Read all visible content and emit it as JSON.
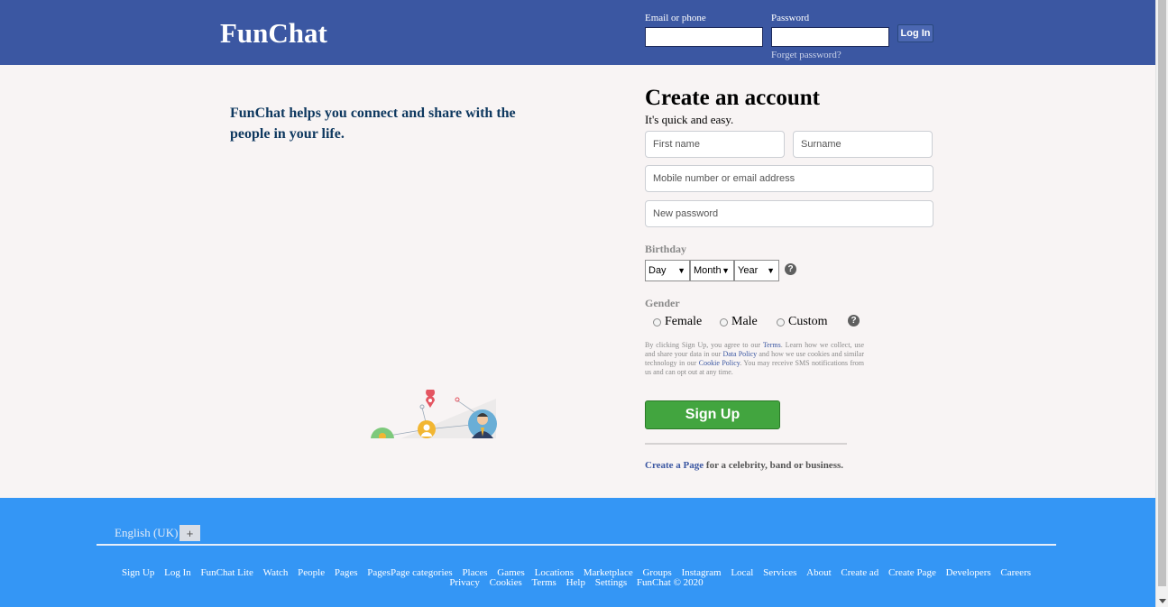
{
  "header": {
    "logo": "FunChat",
    "email_label": "Email or phone",
    "email_value": "",
    "password_label": "Password",
    "password_value": "",
    "login_button": "Log In",
    "forgot_link": "Forget password?"
  },
  "main": {
    "tagline": "FunChat helps you connect and share with the people in your life."
  },
  "register": {
    "title": "Create an account",
    "subtitle": "It's quick and easy.",
    "first_name_placeholder": "First name",
    "surname_placeholder": "Surname",
    "contact_placeholder": "Mobile number or email address",
    "password_placeholder": "New password",
    "birthday_label": "Birthday",
    "day": "Day",
    "month": "Month",
    "year": "Year",
    "gender_label": "Gender",
    "gender_options": [
      "Female",
      "Male",
      "Custom"
    ],
    "terms_parts": [
      "By clicking Sign Up, you agree to our ",
      "Terms",
      ". Learn how we collect, use and share your data in our ",
      "Data Policy",
      " and how we use cookies and similar technology in our ",
      "Cookie Policy",
      ". You may receive SMS notifications from us and can opt out at any time."
    ],
    "signup_button": "Sign Up",
    "create_page_link": "Create a Page",
    "create_page_rest": " for a celebrity, band or business."
  },
  "footer": {
    "language": "English (UK)",
    "add_language": "+",
    "links_row1": [
      "Sign Up",
      "Log In",
      "FunChat Lite",
      "Watch",
      "People",
      "Pages",
      "PagesPage categories",
      "Places",
      "Games",
      "Locations",
      "Marketplace",
      "Groups",
      "Instagram",
      "Local",
      "Services",
      "About",
      "Create ad",
      "Create Page",
      "Developers",
      "Careers"
    ],
    "links_row2": [
      "Privacy",
      "Cookies",
      "Terms",
      "Help",
      "Settings",
      "FunChat © 2020"
    ]
  },
  "colors": {
    "header_bg": "#3b57a2",
    "footer_bg": "#3496f5",
    "signup_green": "#42a53f",
    "tagline_blue": "#0e385f"
  }
}
